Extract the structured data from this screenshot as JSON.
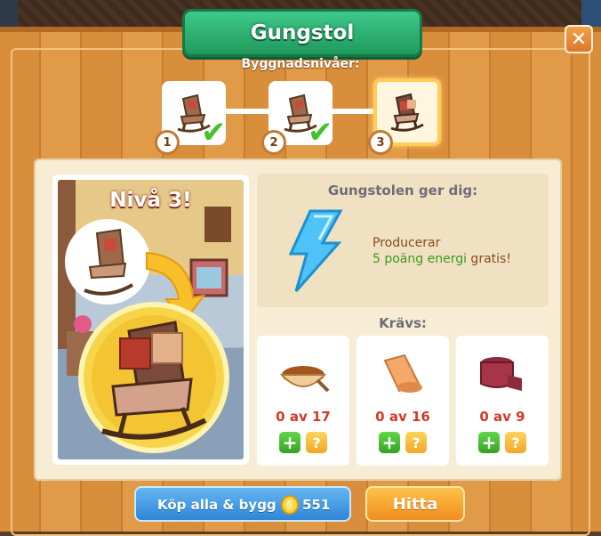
{
  "dialog": {
    "title": "Gungstol",
    "close_icon": "close-icon"
  },
  "levels": {
    "label": "Byggnadsnivåer:",
    "items": [
      {
        "number": "1",
        "completed": true
      },
      {
        "number": "2",
        "completed": true
      },
      {
        "number": "3",
        "completed": false,
        "active": true
      }
    ]
  },
  "preview": {
    "title": "Nivå 3!"
  },
  "gives": {
    "title": "Gungstolen ger dig:",
    "icon": "energy-bolt-icon",
    "line1": "Producerar",
    "line2_highlight": "5 poäng energi",
    "line2_rest": " gratis!"
  },
  "requires": {
    "label": "Krävs:",
    "items": [
      {
        "icon": "bowl-of-powder-icon",
        "count": "0 av 17"
      },
      {
        "icon": "fabric-roll-icon",
        "count": "0 av 16"
      },
      {
        "icon": "ribbon-spool-icon",
        "count": "0 av 9"
      }
    ]
  },
  "actions": {
    "buy_label": "Köp alla & bygg",
    "buy_price": "551",
    "find_label": "Hitta"
  },
  "colors": {
    "ribbon": "#1f9a5c",
    "wood": "#d98e3c",
    "parchment": "#f7ecd4",
    "count_red": "#d03a2a",
    "energy_green": "#3c9a1e",
    "buy_blue": "#2f86d6",
    "find_orange": "#f08e1f"
  }
}
